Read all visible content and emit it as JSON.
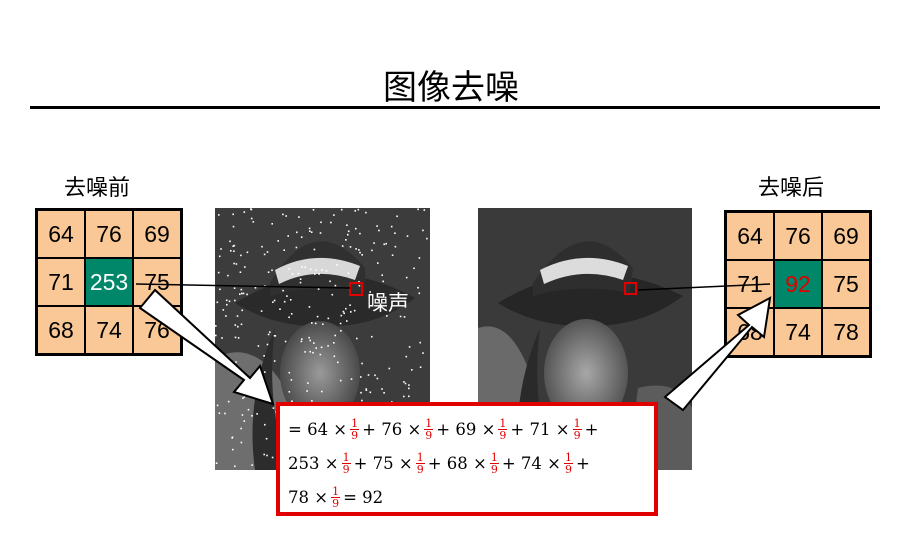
{
  "title": "图像去噪",
  "before_label": "去噪前",
  "after_label": "去噪后",
  "noise_label": "噪声",
  "before_grid": [
    "64",
    "76",
    "69",
    "71",
    "253",
    "75",
    "68",
    "74",
    "76"
  ],
  "after_grid": [
    "64",
    "76",
    "69",
    "71",
    "92",
    "75",
    "68",
    "74",
    "78"
  ],
  "formula": {
    "fraction_num": "1",
    "fraction_den": "9",
    "line1": [
      "= 64 ×",
      "+ 76 ×",
      "+ 69 ×",
      "+ 71 ×",
      "+"
    ],
    "line2": [
      "253 ×",
      "+ 75 ×",
      "+ 68 ×",
      "+ 74 ×",
      "+"
    ],
    "line3": [
      "78 ×",
      "= 92"
    ]
  },
  "colors": {
    "cell_fill": "#fac896",
    "highlight": "#00876a",
    "accent_red": "#e00000"
  }
}
